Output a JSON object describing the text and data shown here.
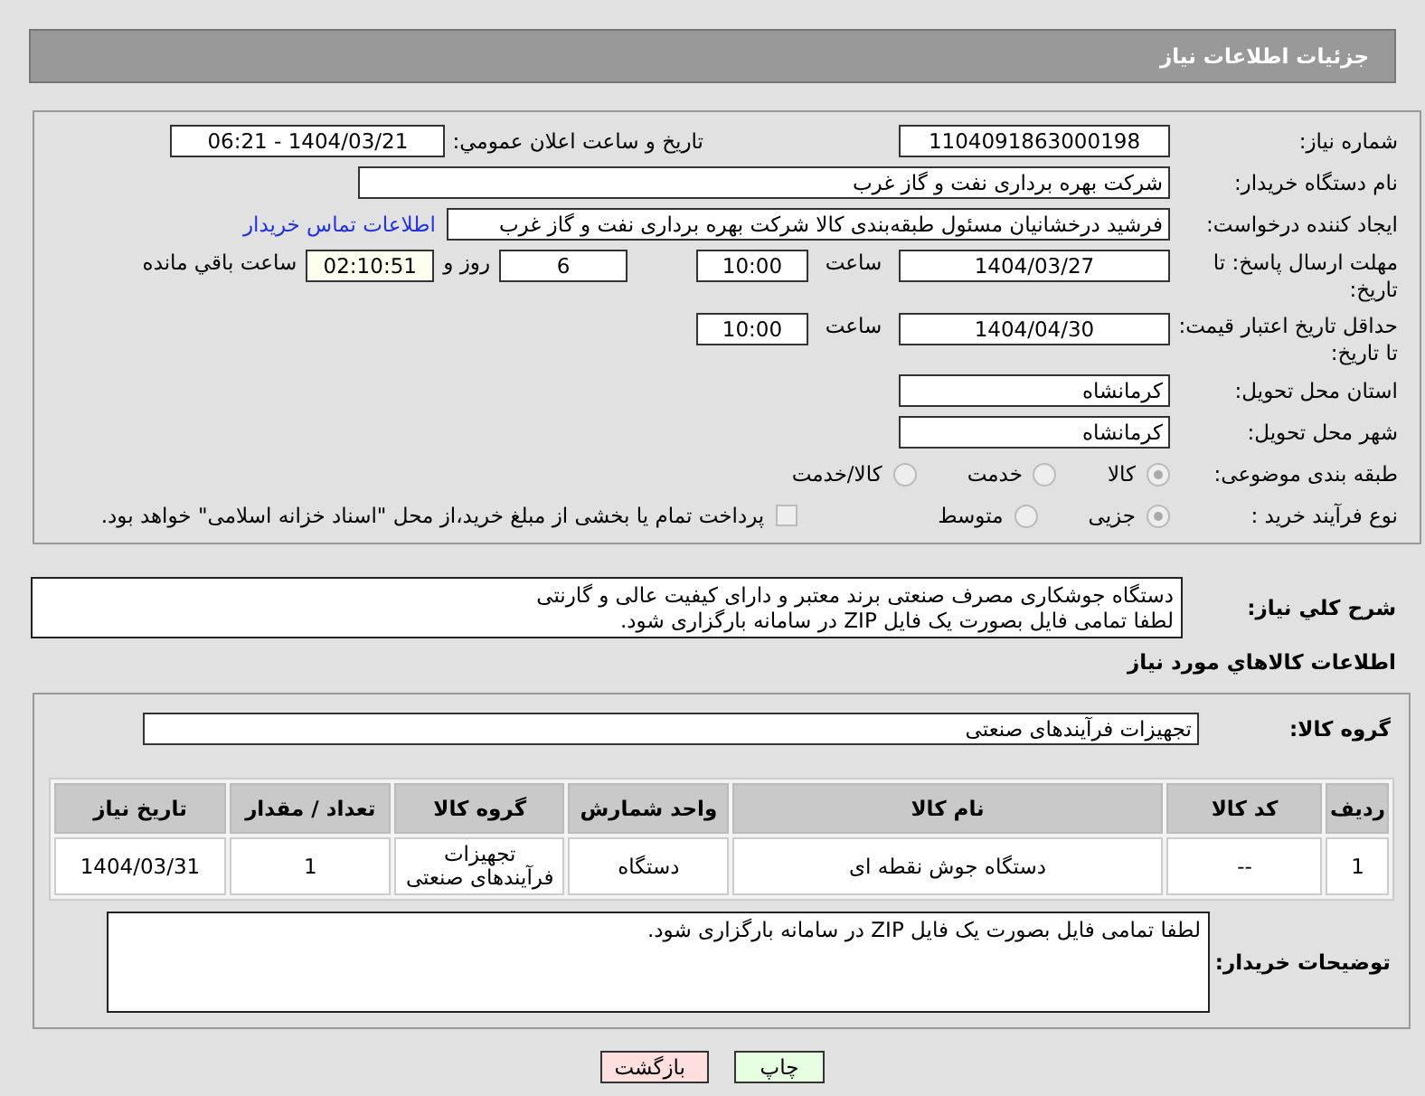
{
  "header": {
    "title": "جزئیات اطلاعات نیاز"
  },
  "need_number": {
    "label": "شماره نیاز:",
    "value": "1104091863000198"
  },
  "announce": {
    "label": "تاریخ و ساعت اعلان عمومي:",
    "value": "1404/03/21 - 06:21"
  },
  "buyer_org": {
    "label": "نام دستگاه خریدار:",
    "value": "شرکت بهره برداری نفت و گاز غرب"
  },
  "requester": {
    "label": "ایجاد کننده درخواست:",
    "value": "فرشید درخشانیان مسئول طبقه‌بندی کالا شرکت بهره برداری نفت و گاز غرب",
    "link": "اطلاعات تماس خریدار"
  },
  "deadline": {
    "label": "مهلت ارسال پاسخ: تا تاریخ:",
    "date": "1404/03/27",
    "time_label": "ساعت",
    "time": "10:00",
    "days": "6",
    "days_label": "روز و",
    "remaining": "02:10:51",
    "remaining_label": "ساعت باقي مانده"
  },
  "validity": {
    "label": "حداقل تاریخ اعتبار قیمت: تا تاریخ:",
    "date": "1404/04/30",
    "time_label": "ساعت",
    "time": "10:00"
  },
  "province": {
    "label": "استان محل تحویل:",
    "value": "کرمانشاه"
  },
  "city": {
    "label": "شهر محل تحویل:",
    "value": "کرمانشاه"
  },
  "category": {
    "label": "طبقه بندی موضوعی:",
    "options": [
      {
        "label": "کالا",
        "selected": true
      },
      {
        "label": "خدمت",
        "selected": false
      },
      {
        "label": "کالا/خدمت",
        "selected": false
      }
    ]
  },
  "process": {
    "label": "نوع فرآیند خرید :",
    "options": [
      {
        "label": "جزیی",
        "selected": true
      },
      {
        "label": "متوسط",
        "selected": false
      }
    ],
    "treasury": {
      "label": "پرداخت تمام یا بخشی از مبلغ خرید،از محل \"اسناد خزانه اسلامی\" خواهد بود.",
      "checked": false
    }
  },
  "description": {
    "label": "شرح کلي نياز:",
    "lines": [
      "دستگاه جوشکاری مصرف صنعتی برند معتبر و دارای کیفیت عالی و گارنتی",
      "لطفا تمامی فایل بصورت یک فایل ZIP در سامانه بارگزاری شود."
    ]
  },
  "goods_heading": "اطلاعات کالاهاي مورد نياز",
  "goods_group": {
    "label": "گروه کالا:",
    "value": "تجهیزات فرآیندهای صنعتی"
  },
  "table": {
    "columns": [
      "ردیف",
      "کد کالا",
      "نام کالا",
      "واحد شمارش",
      "گروه کالا",
      "تعداد / مقدار",
      "تاریخ نیاز"
    ],
    "rows": [
      [
        "1",
        "--",
        "دستگاه جوش نقطه ای",
        "دستگاه",
        "تجهیزات فرآیندهای صنعتی",
        "1",
        "1404/03/31"
      ]
    ]
  },
  "buyer_notes": {
    "label": "توضیحات خریدار:",
    "value": "لطفا تمامی فایل بصورت یک فایل ZIP در سامانه بارگزاری شود."
  },
  "buttons": [
    {
      "label": "چاپ",
      "kind": "print"
    },
    {
      "label": "بازگشت",
      "kind": "back"
    }
  ]
}
